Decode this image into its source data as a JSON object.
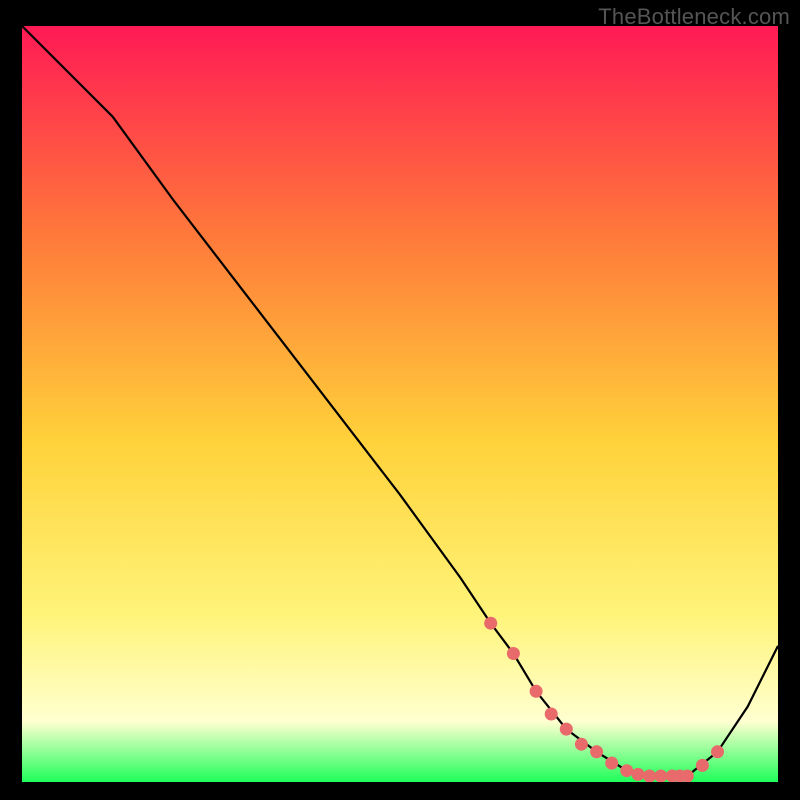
{
  "watermark": "TheBottleneck.com",
  "colors": {
    "bg": "#000000",
    "grad_top": "#ff1a55",
    "grad_mid_upper": "#ff7a3a",
    "grad_mid": "#ffd23a",
    "grad_lower": "#fff47a",
    "grad_pale": "#ffffd0",
    "grad_bottom": "#1eff5a",
    "line": "#000000",
    "marker": "#e86a6a"
  },
  "chart_data": {
    "type": "line",
    "title": "",
    "xlabel": "",
    "ylabel": "",
    "xlim": [
      0,
      100
    ],
    "ylim": [
      0,
      100
    ],
    "series": [
      {
        "name": "curve",
        "x": [
          0,
          8,
          12,
          20,
          30,
          40,
          50,
          58,
          62,
          65,
          68,
          72,
          76,
          80,
          83,
          86,
          88,
          92,
          96,
          100
        ],
        "y": [
          100,
          92,
          88,
          77,
          64,
          51,
          38,
          27,
          21,
          17,
          12,
          7,
          4,
          1.5,
          0.8,
          0.8,
          0.8,
          4,
          10,
          18
        ]
      }
    ],
    "markers": {
      "name": "highlight-dots",
      "x": [
        62,
        65,
        68,
        70,
        72,
        74,
        76,
        78,
        80,
        81.5,
        83,
        84.5,
        86,
        87,
        88,
        90,
        92
      ],
      "y": [
        21,
        17,
        12,
        9,
        7,
        5,
        4,
        2.5,
        1.5,
        1.0,
        0.8,
        0.8,
        0.8,
        0.8,
        0.8,
        2.2,
        4
      ]
    }
  }
}
